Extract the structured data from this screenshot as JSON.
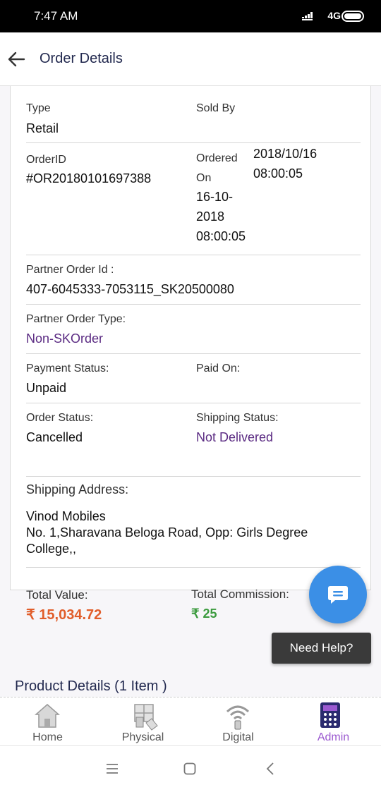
{
  "status_bar": {
    "time": "7:47 AM",
    "network": "4G"
  },
  "header": {
    "title": "Order Details"
  },
  "order": {
    "type_label": "Type",
    "type_value": "Retail",
    "sold_by_label": "Sold By",
    "order_id_label": "OrderID",
    "order_id_value": "#OR20180101697388",
    "ordered_on_label_1": "Ordered",
    "ordered_on_label_2": "On",
    "ordered_on_date_1": "2018/10/16",
    "ordered_on_time_1": "08:00:05",
    "ordered_on_date_2": "16-10-",
    "ordered_on_year_2": "2018",
    "ordered_on_time_2": "08:00:05",
    "partner_order_id_label": "Partner Order Id :",
    "partner_order_id_value": "407-6045333-7053115_SK20500080",
    "partner_order_type_label": "Partner Order Type:",
    "partner_order_type_value": "Non-SKOrder",
    "payment_status_label": "Payment Status:",
    "payment_status_value": "Unpaid",
    "paid_on_label": "Paid On:",
    "order_status_label": "Order Status:",
    "order_status_value": "Cancelled",
    "shipping_status_label": "Shipping Status:",
    "shipping_status_value": "Not Delivered",
    "shipping_address_label": "Shipping Address:",
    "shipping_address_name": "Vinod Mobiles",
    "shipping_address_line1": "No. 1,Sharavana Beloga Road, Opp: Girls Degree",
    "shipping_address_line2": "College,,"
  },
  "totals": {
    "total_value_label": "Total Value:",
    "total_value": "₹ 15,034.72",
    "total_commission_label": "Total Commission:",
    "total_commission": "₹ 25"
  },
  "help": {
    "label": "Need Help?"
  },
  "product_details": {
    "title": "Product Details (1 Item )"
  },
  "bottom_nav": {
    "items": [
      {
        "label": "Home",
        "icon": "home-icon"
      },
      {
        "label": "Physical",
        "icon": "physical-store-icon"
      },
      {
        "label": "Digital",
        "icon": "digital-wifi-icon"
      },
      {
        "label": "Admin",
        "icon": "calculator-icon"
      }
    ],
    "active": "Admin"
  },
  "colors": {
    "accent_purple": "#5a2a82",
    "total_value_orange": "#e15d2a",
    "commission_green": "#3c9b3f",
    "fab_blue": "#3b8fe6",
    "header_navy": "#22294f",
    "nav_active": "#9b59d0"
  }
}
